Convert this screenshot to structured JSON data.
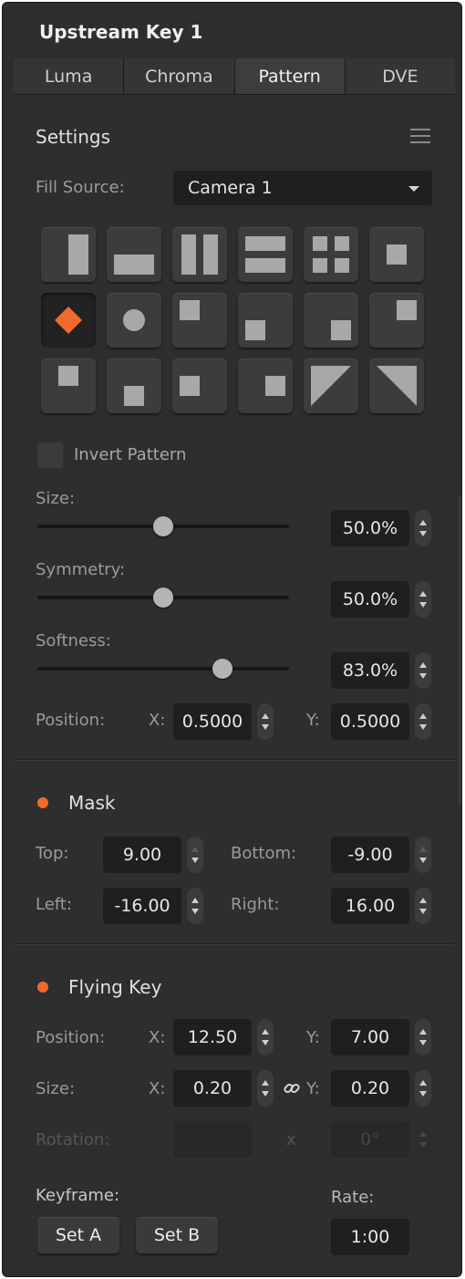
{
  "window": {
    "title": "Upstream Key 1"
  },
  "tabs": [
    {
      "label": "Luma",
      "active": false
    },
    {
      "label": "Chroma",
      "active": false
    },
    {
      "label": "Pattern",
      "active": true
    },
    {
      "label": "DVE",
      "active": false
    }
  ],
  "settings": {
    "title": "Settings",
    "fill_source_label": "Fill Source:",
    "fill_source_value": "Camera 1",
    "patterns": [
      "vertical-bar-right",
      "horizontal-bar-bottom",
      "vertical-bars-two",
      "horizontal-bars-two",
      "four-squares",
      "center-square",
      "diamond",
      "circle",
      "top-left-box",
      "bottom-left-box",
      "bottom-right-box",
      "top-right-box",
      "top-center-box",
      "bottom-center-box",
      "left-center-box",
      "right-center-box",
      "diagonal-bottom-left",
      "diagonal-top-right"
    ],
    "selected_pattern": "diamond",
    "invert_label": "Invert Pattern",
    "invert_checked": false,
    "size_label": "Size:",
    "size_value": "50.0%",
    "size_level": 0.5,
    "symmetry_label": "Symmetry:",
    "symmetry_value": "50.0%",
    "symmetry_level": 0.5,
    "softness_label": "Softness:",
    "softness_value": "83.0%",
    "softness_level": 0.83,
    "position_label": "Position:",
    "x_label": "X:",
    "y_label": "Y:",
    "position_x": "0.5000",
    "position_y": "0.5000"
  },
  "mask": {
    "title": "Mask",
    "enabled": true,
    "top_label": "Top:",
    "top_value": "9.00",
    "bottom_label": "Bottom:",
    "bottom_value": "-9.00",
    "left_label": "Left:",
    "left_value": "-16.00",
    "right_label": "Right:",
    "right_value": "16.00"
  },
  "flying_key": {
    "title": "Flying Key",
    "enabled": true,
    "position_label": "Position:",
    "size_label": "Size:",
    "rotation_label": "Rotation:",
    "x_label": "X:",
    "y_label": "Y:",
    "rotation_x_label": "x",
    "position_x": "12.50",
    "position_y": "7.00",
    "size_x": "0.20",
    "size_y": "0.20",
    "rotation_value": "0°",
    "keyframe_label": "Keyframe:",
    "rate_label": "Rate:",
    "set_a_label": "Set A",
    "set_b_label": "Set B",
    "rate_value": "1:00"
  },
  "colors": {
    "accent": "#f06a2a",
    "panel": "#2e2e2e",
    "field": "#1f1f1f",
    "pattern_fill": "#a8a8a8"
  }
}
